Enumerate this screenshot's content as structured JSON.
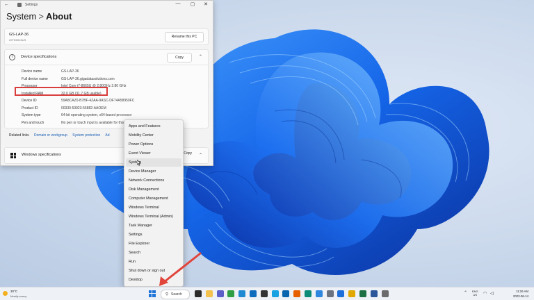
{
  "settings_window": {
    "title": "Settings",
    "controls": {
      "minimize": "—",
      "maximize": "▢",
      "close": "✕"
    },
    "back": "←",
    "breadcrumb": {
      "parent": "System",
      "separator": ">",
      "current": "About"
    },
    "device": {
      "name": "GS-LAP-36",
      "model": "20TD0016US",
      "rename_label": "Rename this PC"
    },
    "specs": {
      "header": "Device specifications",
      "copy_label": "Copy",
      "rows": [
        {
          "key": "Device name",
          "value": "GS-LAP-36"
        },
        {
          "key": "Full device name",
          "value": "GS-LAP-36.gigadatasolutions.com"
        },
        {
          "key": "Processor",
          "value": "Intel Core i7-8665U @ 2.80GHz   2.80 GHz"
        },
        {
          "key": "Installed RAM",
          "value": "32.0 GB (31.7 GB usable)"
        },
        {
          "key": "Device ID",
          "value": "59A8CAZ0-B7BF-4ZAA-9ASC-DF74A58950FC"
        },
        {
          "key": "Product ID",
          "value": "00330-53923-56882-AAOEM"
        },
        {
          "key": "System type",
          "value": "64-bit operating system, x64-based processor"
        },
        {
          "key": "Pen and touch",
          "value": "No pen or touch input is available for this display"
        }
      ]
    },
    "related": {
      "label": "Related links",
      "links": [
        "Domain or workgroup",
        "System protection",
        "Ad"
      ]
    },
    "windows_specs": {
      "label": "Windows specifications",
      "copy_label": "Copy"
    }
  },
  "winx_menu": {
    "items": [
      "Apps and Features",
      "Mobility Center",
      "Power Options",
      "Event Viewer",
      "System",
      "Device Manager",
      "Network Connections",
      "Disk Management",
      "Computer Management",
      "Windows Terminal",
      "Windows Terminal (Admin)",
      "Task Manager",
      "Settings",
      "File Explorer",
      "Search",
      "Run",
      "Shut down or sign out",
      "Desktop"
    ],
    "hovered": "System"
  },
  "taskbar": {
    "weather": {
      "temp": "30°C",
      "condition": "Mostly sunny"
    },
    "search_label": "Search",
    "apps": [
      {
        "name": "task-view-icon",
        "color": "#2b2b2b"
      },
      {
        "name": "file-explorer-icon",
        "color": "#f2c14e"
      },
      {
        "name": "chat-icon",
        "color": "#5b5fc7"
      },
      {
        "name": "chrome-icon",
        "color": "#2f9e44"
      },
      {
        "name": "edge-icon",
        "color": "#1f8ad2"
      },
      {
        "name": "store-icon",
        "color": "#0f6cbd"
      },
      {
        "name": "terminal-icon",
        "color": "#333333"
      },
      {
        "name": "skype-icon",
        "color": "#1aa1e2"
      },
      {
        "name": "outlook-icon",
        "color": "#0a64ad"
      },
      {
        "name": "firefox-icon",
        "color": "#e66000"
      },
      {
        "name": "edge-dev-icon",
        "color": "#0c8b78"
      },
      {
        "name": "photos-icon",
        "color": "#2e86de"
      },
      {
        "name": "notepad-icon",
        "color": "#6b7280"
      },
      {
        "name": "remote-desktop-icon",
        "color": "#1e6fd9"
      },
      {
        "name": "chrome-canary-icon",
        "color": "#e0a800"
      },
      {
        "name": "excel-icon",
        "color": "#1d7044"
      },
      {
        "name": "word-icon",
        "color": "#2b579a"
      },
      {
        "name": "settings-icon",
        "color": "#6b6b6b"
      }
    ],
    "language": {
      "lang": "ENG",
      "region": "US"
    },
    "time": "11:26 AM",
    "date": "2023-06-14"
  },
  "colors": {
    "accent": "#1d74d8",
    "highlight": "#d93d3d"
  }
}
